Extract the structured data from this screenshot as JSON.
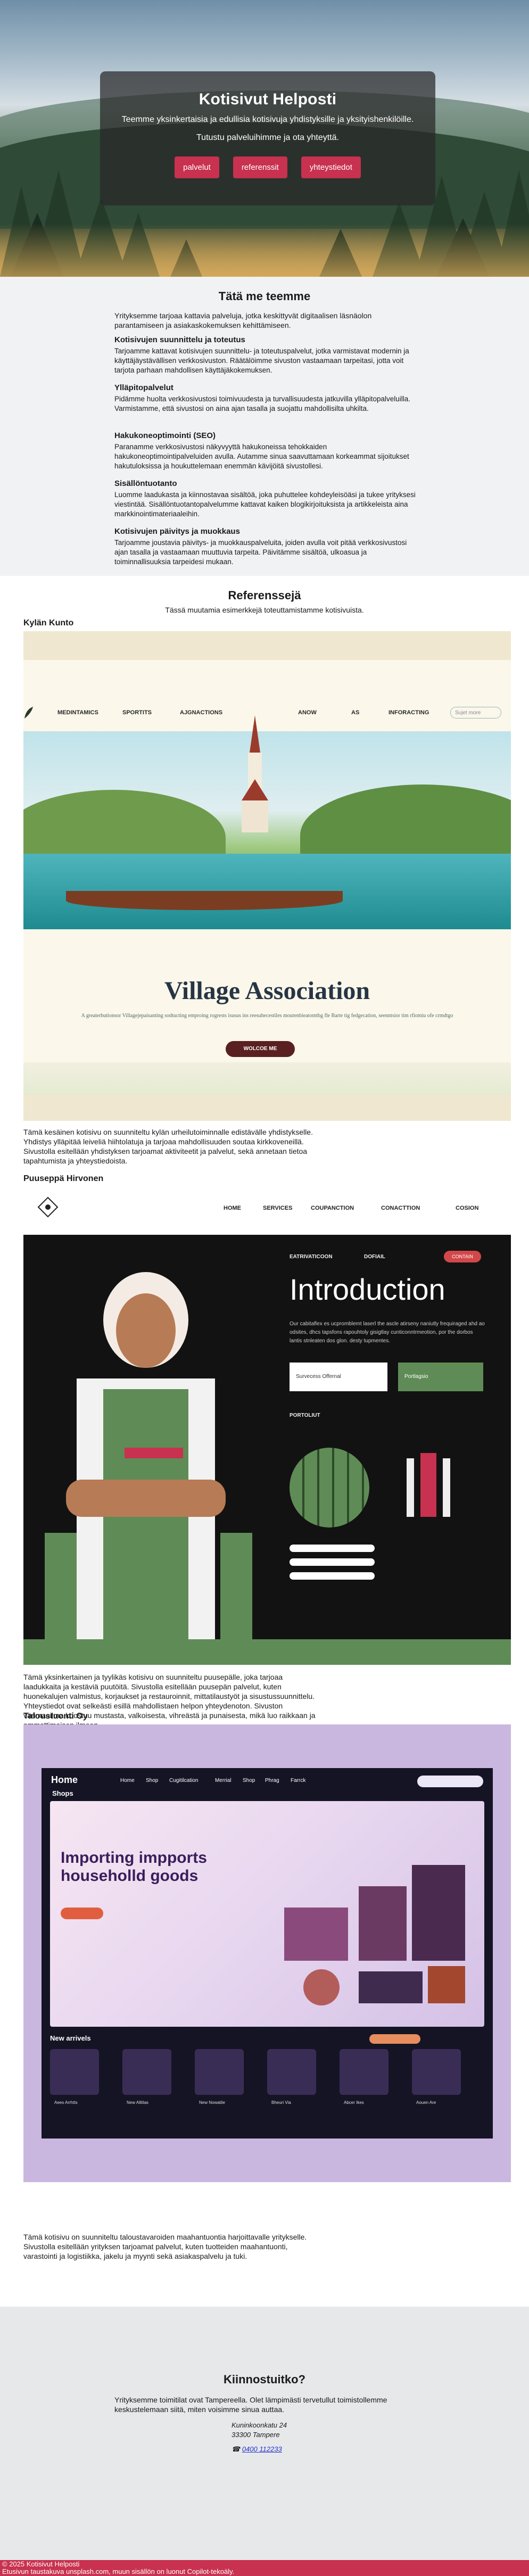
{
  "hero": {
    "title": "Kotisivut Helposti",
    "tagline": "Teemme yksinkertaisia ja edullisia kotisivuja yhdistyksille ja yksityishenkilöille.",
    "tagline2": "Tutustu palveluihimme ja ota yhteyttä.",
    "buttons": [
      "palvelut",
      "referenssit",
      "yhteystiedot"
    ]
  },
  "services": {
    "heading": "Tätä me teemme",
    "intro": "Yrityksemme tarjoaa kattavia palveluja, jotka keskittyvät digitaalisen läsnäolon parantamiseen ja asiakaskokemuksen kehittämiseen.",
    "items": [
      {
        "title": "Kotisivujen suunnittelu ja toteutus",
        "text": "Tarjoamme kattavat kotisivujen suunnittelu- ja toteutuspalvelut, jotka varmistavat modernin ja käyttäjäystävällisen verkkosivuston. Räätälöimme sivuston vastaamaan tarpeitasi, jotta voit tarjota parhaan mahdollisen käyttäjäkokemuksen."
      },
      {
        "title": "Ylläpitopalvelut",
        "text": "Pidämme huolta verkkosivustosi toimivuudesta ja turvallisuudesta jatkuvilla ylläpitopalveluilla. Varmistamme, että sivustosi on aina ajan tasalla ja suojattu mahdollisilta uhkilta."
      },
      {
        "title": "Hakukoneoptimointi (SEO)",
        "text": "Paranamme verkkosivustosi näkyvyyttä hakukoneissa tehokkaiden hakukoneoptimointipalveluiden avulla. Autamme sinua saavuttamaan korkeammat sijoitukset hakutuloksissa ja houkuttelemaan enemmän kävijöitä sivustollesi."
      },
      {
        "title": "Sisällöntuotanto",
        "text": "Luomme laadukasta ja kiinnostavaa sisältöä, joka puhuttelee kohdeyleisöäsi ja tukee yrityksesi viestintää. Sisällöntuotantopalvelumme kattavat kaiken blogikirjoituksista ja artikkeleista aina markkinointimateriaaleihin."
      },
      {
        "title": "Kotisivujen päivitys ja muokkaus",
        "text": "Tarjoamme joustavia päivitys- ja muokkauspalveluita, joiden avulla voit pitää verkkosivustosi ajan tasalla ja vastaamaan muuttuvia tarpeita. Päivitämme sisältöä, ulkoasua ja toiminnallisuuksia tarpeidesi mukaan."
      }
    ]
  },
  "references": {
    "heading": "Referenssejä",
    "subheading": "Tässä muutamia esimerkkejä toteuttamistamme kotisivuista.",
    "items": [
      {
        "name": "Kylän Kunto",
        "description": "Tämä kesäinen kotisivu on suunniteltu kylän urheilutoiminnalle edistävälle yhdistykselle. Yhdistys ylläpitää leiveliä hiihtolatuja ja tarjoaa mahdollisuuden soutaa kirkkoveneillä. Sivustolla esitellään yhdistyksen tarjoamat aktiviteetit ja palvelut, sekä annetaan tietoa tapahtumista ja yhteystiedoista.",
        "mock": {
          "nav": [
            "MEDINTAMICS",
            "SPORTITS",
            "AJGNACTIONS",
            "ANOW",
            "AS",
            "INFORACTING"
          ],
          "search": "Sujet more",
          "title": "Village Association",
          "tagline": "A greaterbutionsor Villagejepaisanting sodtucting emproing rogrests isusus ins reesuhecestiles moutenbieatomtbg fle Barte tig fedgecation, seenntsior tim rfiomiu ofe crmdtgo",
          "cta": "WOLCOE ME"
        }
      },
      {
        "name": "Puuseppä Hirvonen",
        "description": "Tämä yksinkertainen ja tyylikäs kotisivu on suunniteltu puusepälle, joka tarjoaa laadukkaita ja kestäviä puutöitä. Sivustolla esitellään puusepän palvelut, kuten huonekalujen valmistus, korjaukset ja restauroinnit, mittatilaustyöt ja sisustussuunnittelu. Yhteystiedot ovat selkeästi esillä mahdollistaen helpon yhteydenoton. Sivuston värimaailma koostuu mustasta, valkoisesta, vihreästä ja punaisesta, mikä luo raikkaan ja ammattimaisen ilmeen.",
        "mock": {
          "nav": [
            "HOME",
            "SERVICES",
            "COUPANCTION",
            "CONACTTION",
            "COSION"
          ],
          "subnav": [
            "EATRIVATICOON",
            "DOFIAIL"
          ],
          "pill": "CONTAIN",
          "heading": "Introduction",
          "body": "Our cabitaflex es ucpromblemt laserl the ascle atirseny naniutly frequiraged ahd ao odsites, dhcs tapsfons rapouhtoly gisigtlay cunticonntrmeotion, por the dorbos lantis stnleaten dos glon. desty tupmentes.",
          "input1": "Survecess Offernal",
          "input2": "Portlagsio",
          "portfolio": "PORTOLIUT"
        }
      },
      {
        "name": "Taloustuonti Oy",
        "description": "Tämä kotisivu on suunniteltu taloustavaroiden maahantuontia harjoittavalle yritykselle. Sivustolla esitellään yrityksen tarjoamat palvelut, kuten tuotteiden maahantuonti, varastointi ja logistiikka, jakelu ja myynti sekä asiakaspalvelu ja tuki.",
        "mock": {
          "logo": "Home",
          "nav": [
            "Home",
            "Shop",
            "Cugitilcation",
            "Merrial",
            "Shop",
            "Phrag",
            "Farrck"
          ],
          "shops": "Shops",
          "heading": "Importing impports householld goods",
          "arrivals": "New arrivels",
          "tiles": [
            "Aees Arrhtts",
            "New Alltilas",
            "New Nowatile",
            "Bheuri Via",
            "Abcer Ikes",
            "Aouen Are"
          ]
        }
      }
    ]
  },
  "contact": {
    "heading": "Kiinnostuitko?",
    "info": "Yrityksemme toimitilat ovat Tampereella. Olet lämpimästi tervetullut toimistollemme keskustelemaan siitä, miten voisimme sinua auttaa.",
    "street": "Kuninkoonkatu 24",
    "city": "33300 Tampere",
    "phone": "0400 112233"
  },
  "footer": {
    "copyright": "© 2025 Kotisivut Helposti",
    "credits": "Etusivun taustakuva unsplash.com, muun sisällön on luonut Copilot-tekoäly."
  },
  "colors": {
    "accent": "#c8314f",
    "section_bg": "#f1f2f3",
    "contact_bg": "#e7e8ea"
  }
}
